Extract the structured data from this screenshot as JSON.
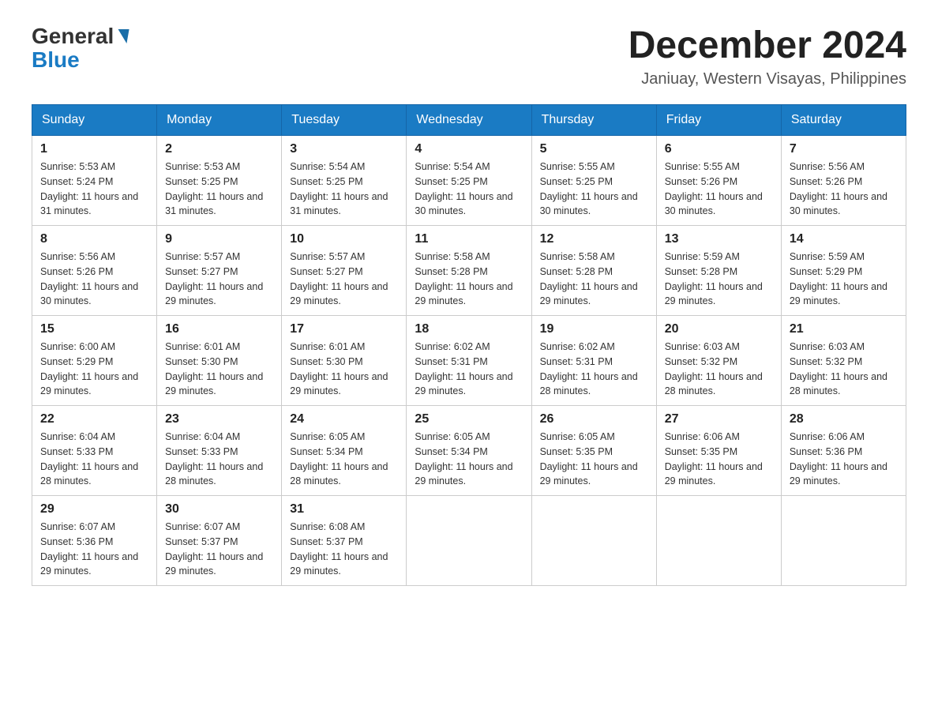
{
  "header": {
    "logo_general": "General",
    "logo_blue": "Blue",
    "main_title": "December 2024",
    "subtitle": "Janiuay, Western Visayas, Philippines"
  },
  "days_of_week": [
    "Sunday",
    "Monday",
    "Tuesday",
    "Wednesday",
    "Thursday",
    "Friday",
    "Saturday"
  ],
  "weeks": [
    [
      {
        "num": "1",
        "sunrise": "5:53 AM",
        "sunset": "5:24 PM",
        "daylight": "11 hours and 31 minutes."
      },
      {
        "num": "2",
        "sunrise": "5:53 AM",
        "sunset": "5:25 PM",
        "daylight": "11 hours and 31 minutes."
      },
      {
        "num": "3",
        "sunrise": "5:54 AM",
        "sunset": "5:25 PM",
        "daylight": "11 hours and 31 minutes."
      },
      {
        "num": "4",
        "sunrise": "5:54 AM",
        "sunset": "5:25 PM",
        "daylight": "11 hours and 30 minutes."
      },
      {
        "num": "5",
        "sunrise": "5:55 AM",
        "sunset": "5:25 PM",
        "daylight": "11 hours and 30 minutes."
      },
      {
        "num": "6",
        "sunrise": "5:55 AM",
        "sunset": "5:26 PM",
        "daylight": "11 hours and 30 minutes."
      },
      {
        "num": "7",
        "sunrise": "5:56 AM",
        "sunset": "5:26 PM",
        "daylight": "11 hours and 30 minutes."
      }
    ],
    [
      {
        "num": "8",
        "sunrise": "5:56 AM",
        "sunset": "5:26 PM",
        "daylight": "11 hours and 30 minutes."
      },
      {
        "num": "9",
        "sunrise": "5:57 AM",
        "sunset": "5:27 PM",
        "daylight": "11 hours and 29 minutes."
      },
      {
        "num": "10",
        "sunrise": "5:57 AM",
        "sunset": "5:27 PM",
        "daylight": "11 hours and 29 minutes."
      },
      {
        "num": "11",
        "sunrise": "5:58 AM",
        "sunset": "5:28 PM",
        "daylight": "11 hours and 29 minutes."
      },
      {
        "num": "12",
        "sunrise": "5:58 AM",
        "sunset": "5:28 PM",
        "daylight": "11 hours and 29 minutes."
      },
      {
        "num": "13",
        "sunrise": "5:59 AM",
        "sunset": "5:28 PM",
        "daylight": "11 hours and 29 minutes."
      },
      {
        "num": "14",
        "sunrise": "5:59 AM",
        "sunset": "5:29 PM",
        "daylight": "11 hours and 29 minutes."
      }
    ],
    [
      {
        "num": "15",
        "sunrise": "6:00 AM",
        "sunset": "5:29 PM",
        "daylight": "11 hours and 29 minutes."
      },
      {
        "num": "16",
        "sunrise": "6:01 AM",
        "sunset": "5:30 PM",
        "daylight": "11 hours and 29 minutes."
      },
      {
        "num": "17",
        "sunrise": "6:01 AM",
        "sunset": "5:30 PM",
        "daylight": "11 hours and 29 minutes."
      },
      {
        "num": "18",
        "sunrise": "6:02 AM",
        "sunset": "5:31 PM",
        "daylight": "11 hours and 29 minutes."
      },
      {
        "num": "19",
        "sunrise": "6:02 AM",
        "sunset": "5:31 PM",
        "daylight": "11 hours and 28 minutes."
      },
      {
        "num": "20",
        "sunrise": "6:03 AM",
        "sunset": "5:32 PM",
        "daylight": "11 hours and 28 minutes."
      },
      {
        "num": "21",
        "sunrise": "6:03 AM",
        "sunset": "5:32 PM",
        "daylight": "11 hours and 28 minutes."
      }
    ],
    [
      {
        "num": "22",
        "sunrise": "6:04 AM",
        "sunset": "5:33 PM",
        "daylight": "11 hours and 28 minutes."
      },
      {
        "num": "23",
        "sunrise": "6:04 AM",
        "sunset": "5:33 PM",
        "daylight": "11 hours and 28 minutes."
      },
      {
        "num": "24",
        "sunrise": "6:05 AM",
        "sunset": "5:34 PM",
        "daylight": "11 hours and 28 minutes."
      },
      {
        "num": "25",
        "sunrise": "6:05 AM",
        "sunset": "5:34 PM",
        "daylight": "11 hours and 29 minutes."
      },
      {
        "num": "26",
        "sunrise": "6:05 AM",
        "sunset": "5:35 PM",
        "daylight": "11 hours and 29 minutes."
      },
      {
        "num": "27",
        "sunrise": "6:06 AM",
        "sunset": "5:35 PM",
        "daylight": "11 hours and 29 minutes."
      },
      {
        "num": "28",
        "sunrise": "6:06 AM",
        "sunset": "5:36 PM",
        "daylight": "11 hours and 29 minutes."
      }
    ],
    [
      {
        "num": "29",
        "sunrise": "6:07 AM",
        "sunset": "5:36 PM",
        "daylight": "11 hours and 29 minutes."
      },
      {
        "num": "30",
        "sunrise": "6:07 AM",
        "sunset": "5:37 PM",
        "daylight": "11 hours and 29 minutes."
      },
      {
        "num": "31",
        "sunrise": "6:08 AM",
        "sunset": "5:37 PM",
        "daylight": "11 hours and 29 minutes."
      },
      null,
      null,
      null,
      null
    ]
  ]
}
